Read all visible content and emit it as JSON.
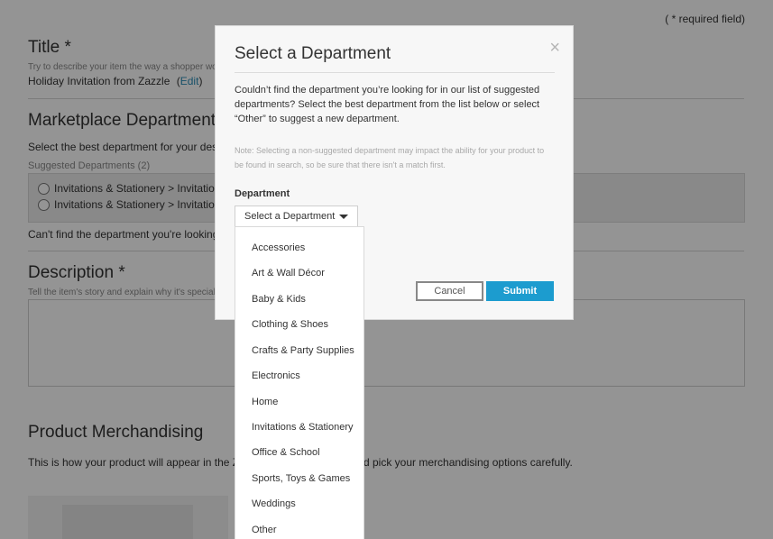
{
  "page": {
    "required_note": "( * required field)",
    "title": {
      "heading": "Title *",
      "hint": "Try to describe your item the way a shopper would.",
      "value": "Holiday Invitation from Zazzle",
      "edit_prefix": "(",
      "edit_link": "Edit",
      "edit_suffix": ")"
    },
    "marketplace": {
      "heading": "Marketplace Department *",
      "instruction": "Select the best department for your des",
      "suggested_label": "Suggested Departments (2)",
      "options": [
        "Invitations & Stationery > Invitations &",
        "Invitations & Stationery > Invitations &"
      ],
      "cant_find": "Can't find the department you're looking for?"
    },
    "description": {
      "heading": "Description *",
      "hint": "Tell the item's story and explain why it's special."
    },
    "merchandising": {
      "heading": "Product Merchandising",
      "text_left": "This is how your product will appear in the Zazzle",
      "text_right": "d pick your merchandising options carefully."
    }
  },
  "modal": {
    "title": "Select a Department",
    "close_icon": "×",
    "body": "Couldn’t find the department you’re looking for in our list of suggested departments? Select the best department from the list below or select “Other” to suggest a new department.",
    "note": "Note: Selecting a non-suggested department may impact the ability for your product to be found in search, so be sure that there isn't a match first.",
    "department_label": "Department",
    "select_value": "Select a Department",
    "cancel_label": "Cancel",
    "submit_label": "Submit"
  },
  "dropdown": {
    "items": [
      "Accessories",
      "Art & Wall Décor",
      "Baby & Kids",
      "Clothing & Shoes",
      "Crafts & Party Supplies",
      "Electronics",
      "Home",
      "Invitations & Stationery",
      "Office & School",
      "Sports, Toys & Games",
      "Weddings",
      "Other"
    ]
  },
  "colors": {
    "accent": "#1c9ccf",
    "link": "#2a8bb5"
  }
}
